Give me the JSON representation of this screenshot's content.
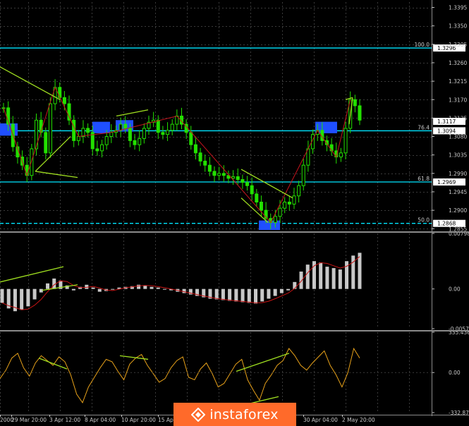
{
  "chart_data": [
    {
      "type": "candlestick",
      "pane": "price",
      "ylim": [
        1.2852,
        1.3408
      ],
      "price_ticks": [
        "1.3395",
        "1.3350",
        "1.3305",
        "1.3260",
        "1.3215",
        "1.3170",
        "1.3125",
        "1.3080",
        "1.3035",
        "1.2990",
        "1.2945",
        "1.2900",
        "1.2855"
      ],
      "levels": [
        {
          "label": "100.0",
          "value": 1.3296,
          "badge": "1.3296"
        },
        {
          "label": "76.4",
          "value": 1.3094,
          "badge": "1.3094"
        },
        {
          "label": "61.8",
          "value": 1.2969,
          "badge": "1.2969"
        },
        {
          "label": "50.0",
          "value": 1.2868,
          "badge": "1.2868"
        }
      ],
      "current_price": "1.3117",
      "series": [
        {
          "values": [
            1.315,
            1.311,
            1.3055,
            1.303,
            1.301,
            1.2985,
            1.305,
            1.312,
            1.309,
            1.304,
            1.316,
            1.32,
            1.3175,
            1.316,
            1.312,
            1.307,
            1.308,
            1.31,
            1.309,
            1.305,
            1.3045,
            1.306,
            1.308,
            1.309,
            1.3095,
            1.311,
            1.31,
            1.307,
            1.306,
            1.3075,
            1.31,
            1.3115,
            1.312,
            1.309,
            1.3085,
            1.3095,
            1.311,
            1.313,
            1.311,
            1.309,
            1.306,
            1.304,
            1.302,
            1.301,
            1.2995,
            1.2985,
            1.299,
            1.2985,
            1.2978,
            1.2982,
            1.2975,
            1.2968,
            1.296,
            1.294,
            1.292,
            1.29,
            1.288,
            1.287,
            1.2885,
            1.2905,
            1.292,
            1.2915,
            1.2935,
            1.296,
            1.301,
            1.305,
            1.3085,
            1.3095,
            1.307,
            1.306,
            1.3045,
            1.303,
            1.304,
            1.31,
            1.317,
            1.3155,
            1.312
          ]
        }
      ],
      "annotations": [
        "blue-zone",
        "blue-zone",
        "blue-zone",
        "blue-zone",
        "blue-zone"
      ]
    },
    {
      "type": "bar",
      "pane": "macd",
      "ylim": [
        -0.00571,
        0.00798
      ],
      "ticks": [
        "0.00798",
        "0.00",
        "-0.00571"
      ],
      "series": [
        {
          "values": [
            -0.002,
            -0.0028,
            -0.0032,
            -0.003,
            -0.0025,
            -0.0015,
            -0.0005,
            0.0008,
            0.0015,
            0.0012,
            0.0005,
            -0.0002,
            0.0003,
            0.0006,
            0.0002,
            -0.0004,
            -0.0003,
            0.0,
            0.0002,
            0.0003,
            0.0004,
            0.0006,
            0.0005,
            0.0003,
            0.0002,
            0.0,
            -0.0002,
            -0.0004,
            -0.0006,
            -0.0008,
            -0.001,
            -0.0012,
            -0.0014,
            -0.0015,
            -0.0016,
            -0.0017,
            -0.0018,
            -0.0019,
            -0.002,
            -0.0021,
            -0.0018,
            -0.0014,
            -0.001,
            -0.0006,
            -0.0002,
            0.001,
            0.0025,
            0.0035,
            0.004,
            0.0038,
            0.0032,
            0.003,
            0.0028,
            0.004,
            0.0048,
            0.0052
          ]
        }
      ]
    },
    {
      "type": "line",
      "pane": "cci",
      "ylim": [
        -332.8745,
        335.4369
      ],
      "ticks": [
        "335.4369",
        "0.00",
        "-332.8745"
      ],
      "series": [
        {
          "values": [
            -50,
            20,
            120,
            160,
            40,
            -30,
            80,
            140,
            100,
            60,
            130,
            90,
            -20,
            -180,
            -250,
            -120,
            -40,
            40,
            110,
            90,
            10,
            -60,
            70,
            120,
            150,
            60,
            -10,
            -80,
            -50,
            40,
            100,
            130,
            -40,
            -60,
            30,
            80,
            -10,
            -120,
            -90,
            -10,
            70,
            110,
            -60,
            -150,
            -230,
            -90,
            -20,
            60,
            100,
            200,
            140,
            60,
            20,
            80,
            130,
            180,
            60,
            -20,
            -120,
            0,
            200,
            120
          ]
        }
      ]
    }
  ],
  "time_labels": [
    "2000",
    "29 Mar 20:00",
    "3 Apr 12:00",
    "8 Apr 04:00",
    "10 Apr 20:00",
    "15 Apr",
    "30 Apr 04:00",
    "2 May 20:00"
  ],
  "brand": {
    "logo_text": "instaforex",
    "color": "#ff6a2a"
  },
  "colors": {
    "candle": "#22e000",
    "level": "#00e5ff",
    "zigzag": "#c8141e",
    "trendline": "#a0e020",
    "zone": "#1f4fff",
    "cci": "#e8a21a",
    "hist": "#c8c8c8",
    "signal": "#c81414"
  }
}
